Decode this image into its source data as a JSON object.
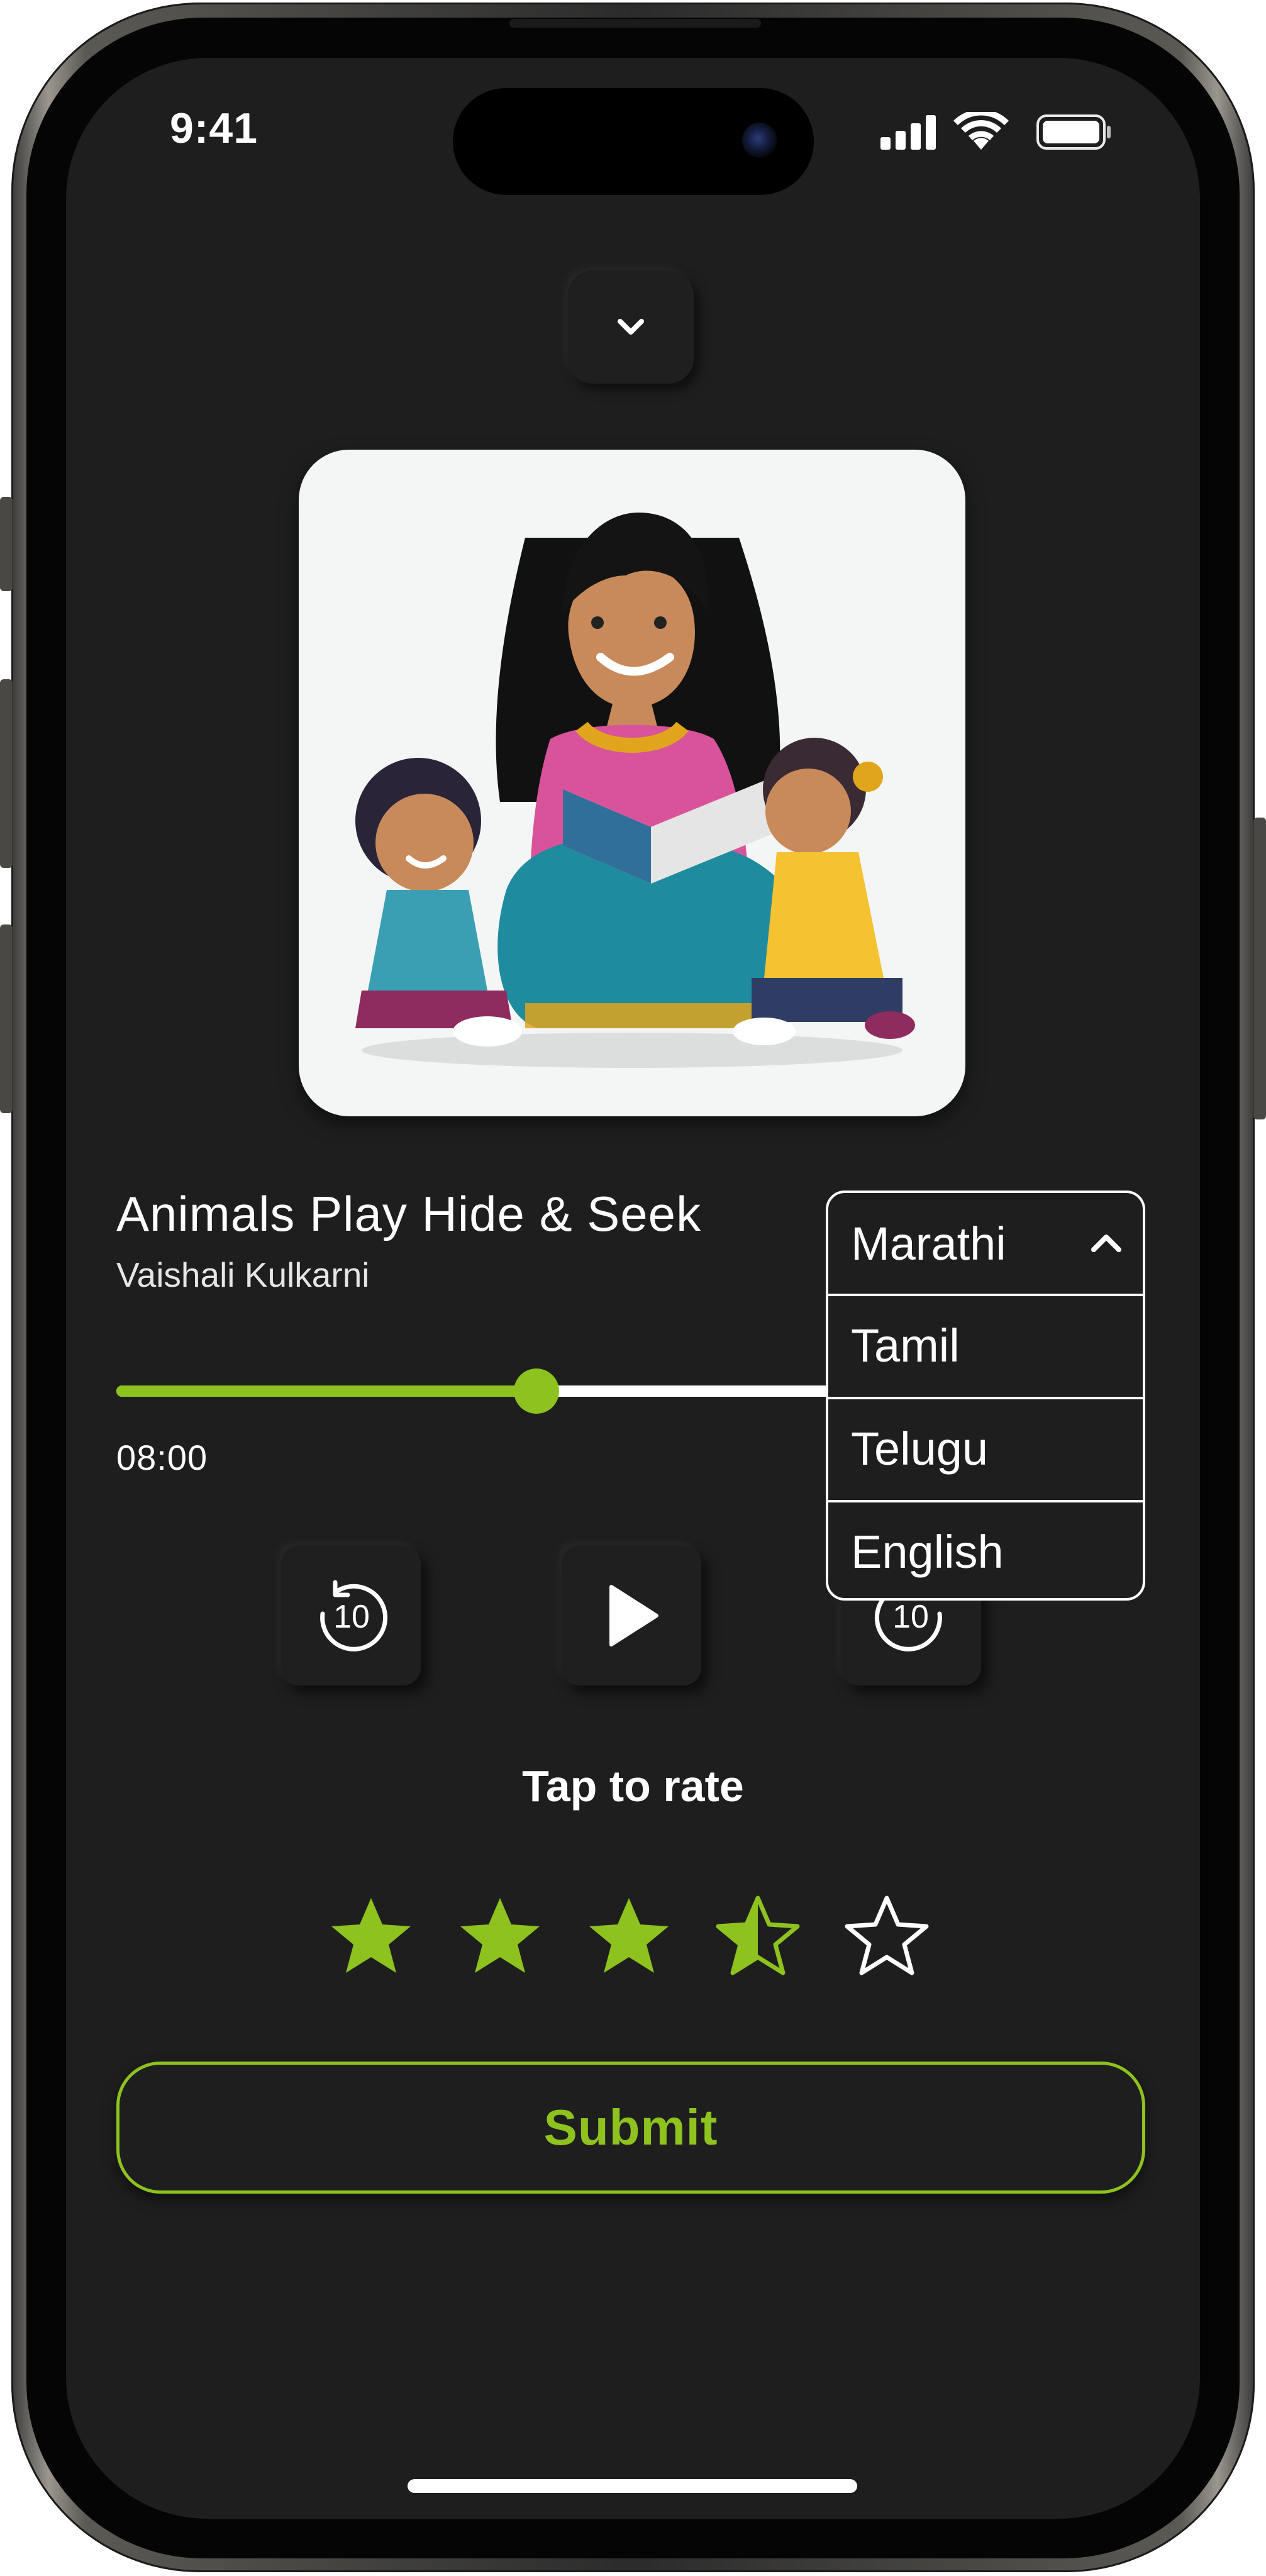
{
  "status_bar": {
    "time": "9:41"
  },
  "player": {
    "title": "Animals Play Hide & Seek",
    "author": "Vaishali Kulkarni",
    "elapsed": "08:00",
    "progress_fraction": 0.41,
    "rewind_seconds": "10",
    "forward_seconds": "10"
  },
  "language_select": {
    "selected": "Marathi",
    "options": [
      "Tamil",
      "Telugu",
      "English"
    ]
  },
  "rating": {
    "label": "Tap to rate",
    "value": 3.5,
    "max": 5
  },
  "submit_label": "Submit",
  "colors": {
    "accent": "#8dc21f",
    "background": "#1e1e1e",
    "text": "#ffffff"
  },
  "icons": {
    "collapse": "chevron-down-icon",
    "rewind": "rewind-10-icon",
    "play": "play-icon",
    "forward": "forward-10-icon",
    "dropdown": "chevron-up-icon"
  }
}
